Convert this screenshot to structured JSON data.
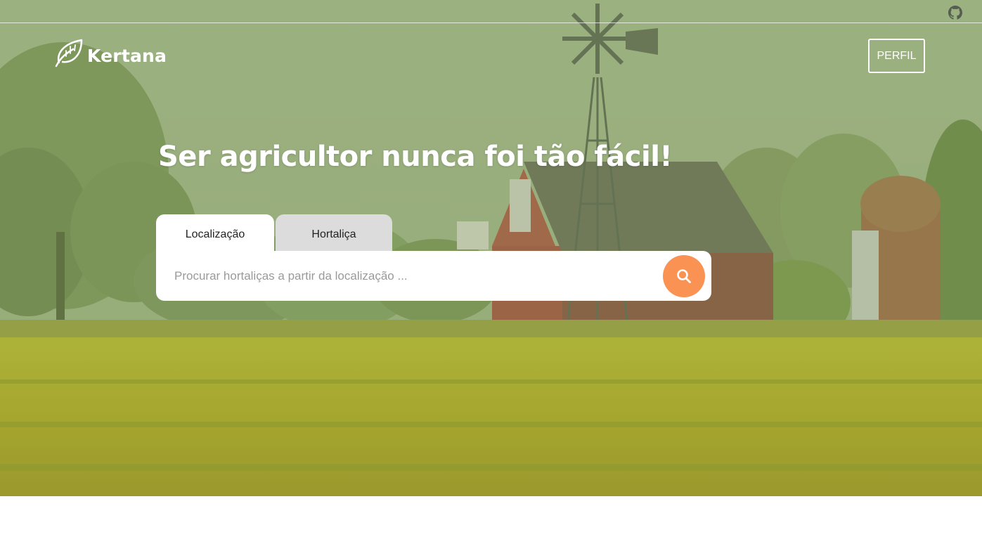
{
  "header": {
    "brand": "Kertana",
    "profile_label": "PERFIL"
  },
  "hero": {
    "headline": "Ser agricultor nunca foi tão fácil!"
  },
  "search": {
    "tabs": [
      {
        "label": "Localização",
        "active": true
      },
      {
        "label": "Hortaliça",
        "active": false
      }
    ],
    "placeholder": "Procurar hortaliças a partir da localização ...",
    "value": ""
  },
  "icons": {
    "github": "github-icon",
    "logo": "leaf-icon",
    "search": "search-icon"
  },
  "colors": {
    "accent": "#fa9254",
    "inactive_tab": "#dcdcdc"
  }
}
